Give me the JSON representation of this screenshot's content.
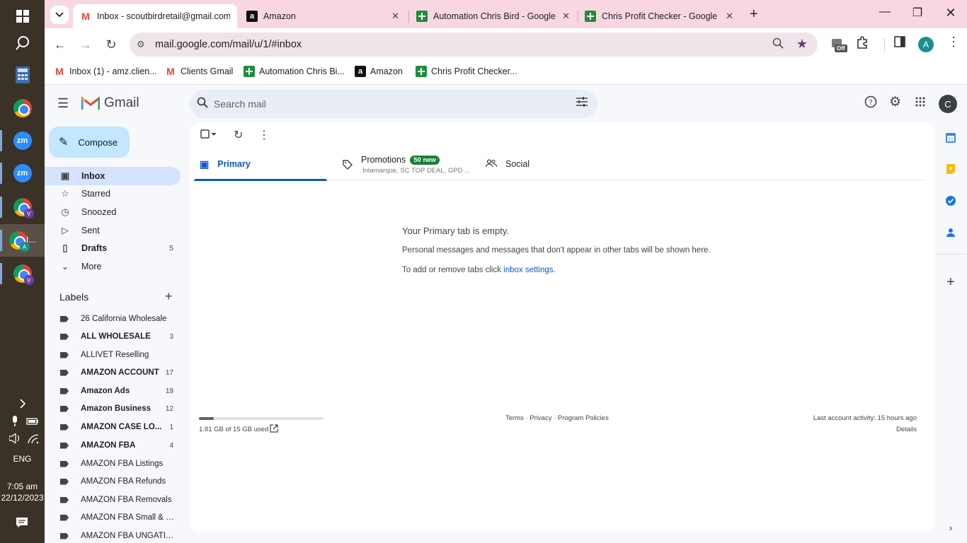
{
  "taskbar": {
    "zoom_label": "zm",
    "zoom2_label": "zm",
    "badge_v": "V",
    "badge_a": "A",
    "active_app_label": "I...",
    "badge_v2": "V",
    "language": "ENG",
    "time": "7:05 am",
    "date": "22/12/2023"
  },
  "browser_tabs": [
    {
      "title": "Inbox - scoutbirdretail@gmail.com",
      "favicon": "gmail"
    },
    {
      "title": "Amazon",
      "favicon": "amazon"
    },
    {
      "title": "Automation Chris Bird - Google Sheets",
      "favicon": "sheets"
    },
    {
      "title": "Chris Profit Checker - Google Sheets",
      "favicon": "sheets"
    }
  ],
  "address_bar": {
    "url": "mail.google.com/mail/u/1/#inbox",
    "profile_initial": "A",
    "ext_label": "Off"
  },
  "bookmarks": [
    {
      "label": "Inbox (1) - amz.clien...",
      "favicon": "gmail"
    },
    {
      "label": "Clients Gmail",
      "favicon": "gmail"
    },
    {
      "label": "Automation Chris Bi...",
      "favicon": "sheets"
    },
    {
      "label": "Amazon",
      "favicon": "amazon"
    },
    {
      "label": "Chris Profit Checker...",
      "favicon": "sheets"
    }
  ],
  "gmail": {
    "logo_text": "Gmail",
    "search_placeholder": "Search mail",
    "account_initial": "C",
    "compose_label": "Compose",
    "nav": [
      {
        "label": "Inbox",
        "count": ""
      },
      {
        "label": "Starred",
        "count": ""
      },
      {
        "label": "Snoozed",
        "count": ""
      },
      {
        "label": "Sent",
        "count": ""
      },
      {
        "label": "Drafts",
        "count": "5"
      },
      {
        "label": "More",
        "count": ""
      }
    ],
    "labels_title": "Labels",
    "labels": [
      {
        "name": "26 California Wholesale",
        "count": ""
      },
      {
        "name": "ALL WHOLESALE",
        "count": "3"
      },
      {
        "name": "ALLIVET Reselling",
        "count": ""
      },
      {
        "name": "AMAZON ACCOUNT",
        "count": "17"
      },
      {
        "name": "Amazon Ads",
        "count": "19"
      },
      {
        "name": "Amazon Business",
        "count": "12"
      },
      {
        "name": "AMAZON CASE LO...",
        "count": "1"
      },
      {
        "name": "AMAZON FBA",
        "count": "4"
      },
      {
        "name": "AMAZON FBA Listings",
        "count": ""
      },
      {
        "name": "AMAZON FBA Refunds",
        "count": ""
      },
      {
        "name": "AMAZON FBA Removals",
        "count": ""
      },
      {
        "name": "AMAZON FBA Small & Li...",
        "count": ""
      },
      {
        "name": "AMAZON FBA UNGATING",
        "count": ""
      }
    ],
    "tabs": [
      {
        "label": "Primary"
      },
      {
        "label": "Promotions",
        "badge": "50 new",
        "subtitle": "Intamarque, SC TOP DEAL, GPD ..."
      },
      {
        "label": "Social"
      }
    ],
    "empty": {
      "title": "Your Primary tab is empty.",
      "description": "Personal messages and messages that don't appear in other tabs will be shown here.",
      "settings_prefix": "To add or remove tabs click ",
      "settings_link": "inbox settings",
      "settings_suffix": "."
    },
    "footer": {
      "storage_text": "1.81 GB of 15 GB used",
      "storage_fraction": 0.12,
      "links": "Terms · Privacy · Program Policies",
      "last_activity": "Last account activity: 15 hours ago",
      "details": "Details"
    }
  },
  "colors": {
    "tabstrip_bg": "#f8d7e3",
    "compose_bg": "#c2e7ff",
    "active_nav_bg": "#d3e3fd",
    "accent_blue": "#0b57d0",
    "badge_green": "#188038"
  }
}
